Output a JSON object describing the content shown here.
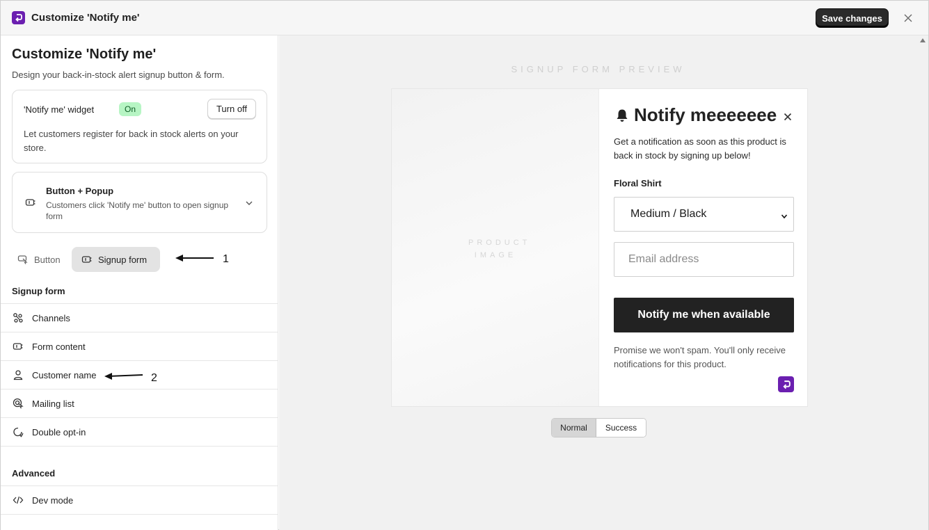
{
  "window": {
    "title": "Customize 'Notify me'",
    "save_label": "Save changes"
  },
  "left": {
    "title": "Customize 'Notify me'",
    "subtitle": "Design your back-in-stock alert signup button & form.",
    "widget": {
      "label": "'Notify me' widget",
      "status": "On",
      "turn_off_label": "Turn off",
      "description": "Let customers register for back in stock alerts on your store."
    },
    "mode": {
      "title": "Button + Popup",
      "description": "Customers click 'Notify me' button to open signup form"
    },
    "segment": {
      "button_label": "Button",
      "signup_label": "Signup form",
      "selected": "Signup form"
    },
    "annotations": [
      "1",
      "2"
    ],
    "signup_section": {
      "heading": "Signup form",
      "items": [
        {
          "label": "Channels",
          "icon": "channels-icon"
        },
        {
          "label": "Form content",
          "icon": "form-content-icon"
        },
        {
          "label": "Customer name",
          "icon": "person-icon"
        },
        {
          "label": "Mailing list",
          "icon": "mailing-list-icon"
        },
        {
          "label": "Double opt-in",
          "icon": "double-opt-in-icon"
        }
      ]
    },
    "advanced_section": {
      "heading": "Advanced",
      "items": [
        {
          "label": "Dev mode",
          "icon": "code-icon"
        }
      ]
    }
  },
  "preview": {
    "label": "SIGNUP FORM PREVIEW",
    "product_image_text": "PRODUCT IMAGE",
    "form_title": "Notify meeeeeee",
    "form_description": "Get a notification as soon as this product is back in stock by signing up below!",
    "product_name": "Floral Shirt",
    "variant_selected": "Medium / Black",
    "email_placeholder": "Email address",
    "submit_label": "Notify me when available",
    "spam_note": "Promise we won't spam. You'll only receive notifications for this product.",
    "state_tabs": [
      {
        "label": "Normal",
        "active": true
      },
      {
        "label": "Success",
        "active": false
      }
    ]
  },
  "colors": {
    "brand": "#6b1fb0",
    "on_badge_bg": "#b7f5c4",
    "primary_button": "#222222"
  }
}
